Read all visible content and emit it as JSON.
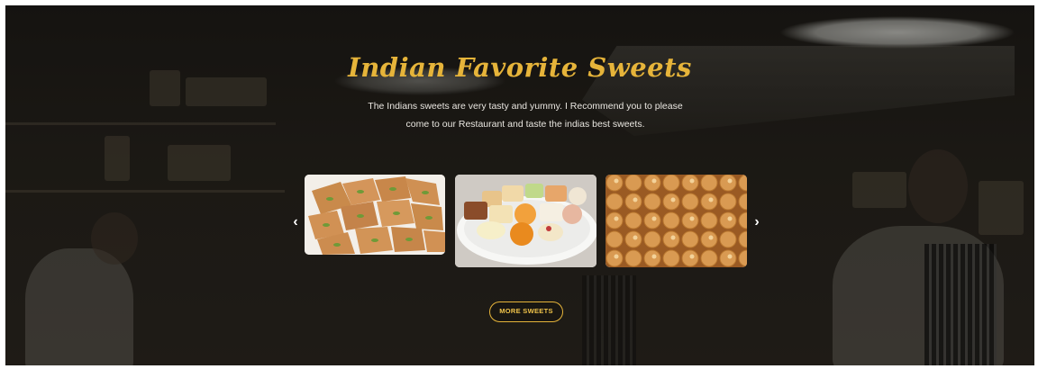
{
  "section": {
    "title": "Indian Favorite Sweets",
    "description": "The Indians sweets are very tasty and yummy. I Recommend you to please come to our Restaurant and taste the indias best sweets."
  },
  "carousel": {
    "prev_icon": "chevron-left-icon",
    "next_icon": "chevron-right-icon",
    "prev_glyph": "‹",
    "next_glyph": "›",
    "items": [
      {
        "icon": "barfi-sweets-image"
      },
      {
        "icon": "assorted-sweets-plate-image"
      },
      {
        "icon": "round-sweets-tray-image"
      }
    ]
  },
  "more_button": {
    "label": "MORE SWEETS"
  },
  "colors": {
    "accent": "#e6b43a",
    "text_light": "#e9e6e0",
    "background": "#241f1a"
  }
}
